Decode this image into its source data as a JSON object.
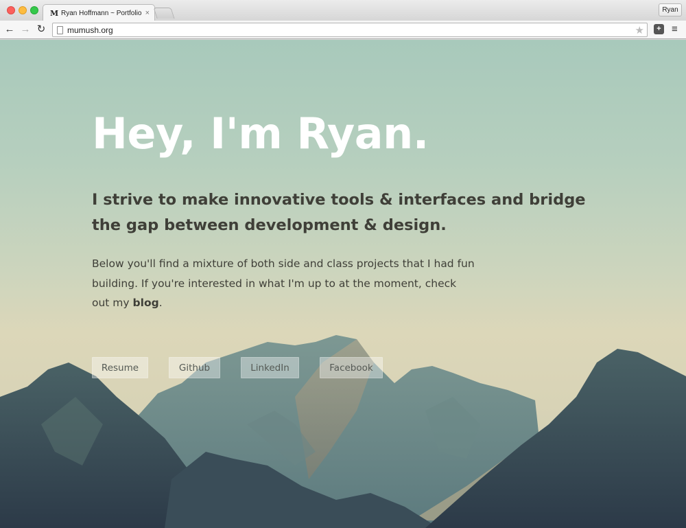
{
  "browser": {
    "tab_title": "Ryan Hoffmann ~ Portfolio",
    "tab_favicon": "M",
    "tab_close": "×",
    "profile_name": "Ryan",
    "url": "mumush.org",
    "icons": {
      "back": "←",
      "forward": "→",
      "reload": "↻",
      "star": "★",
      "extension": "+",
      "menu": "≡"
    }
  },
  "hero": {
    "title": "Hey, I'm Ryan.",
    "subtitle": "I strive to make innovative tools & interfaces and bridge the gap between development & design.",
    "body_text": "Below you'll find a mixture of both side and class projects that I had fun building. If you're interested in what I'm up to at the moment, check out my",
    "blog_link": "blog",
    "body_end": "."
  },
  "links": {
    "resume": "Resume",
    "github": "Github",
    "linkedin": "LinkedIn",
    "facebook": "Facebook"
  },
  "colors": {
    "sky_top": "#a8c9bb",
    "sky_horizon": "#dcd7b9",
    "mountain_far": "#6f8d8b",
    "mountain_near": "#34475a",
    "title_text": "#ffffff",
    "body_text": "#3f3f38"
  }
}
